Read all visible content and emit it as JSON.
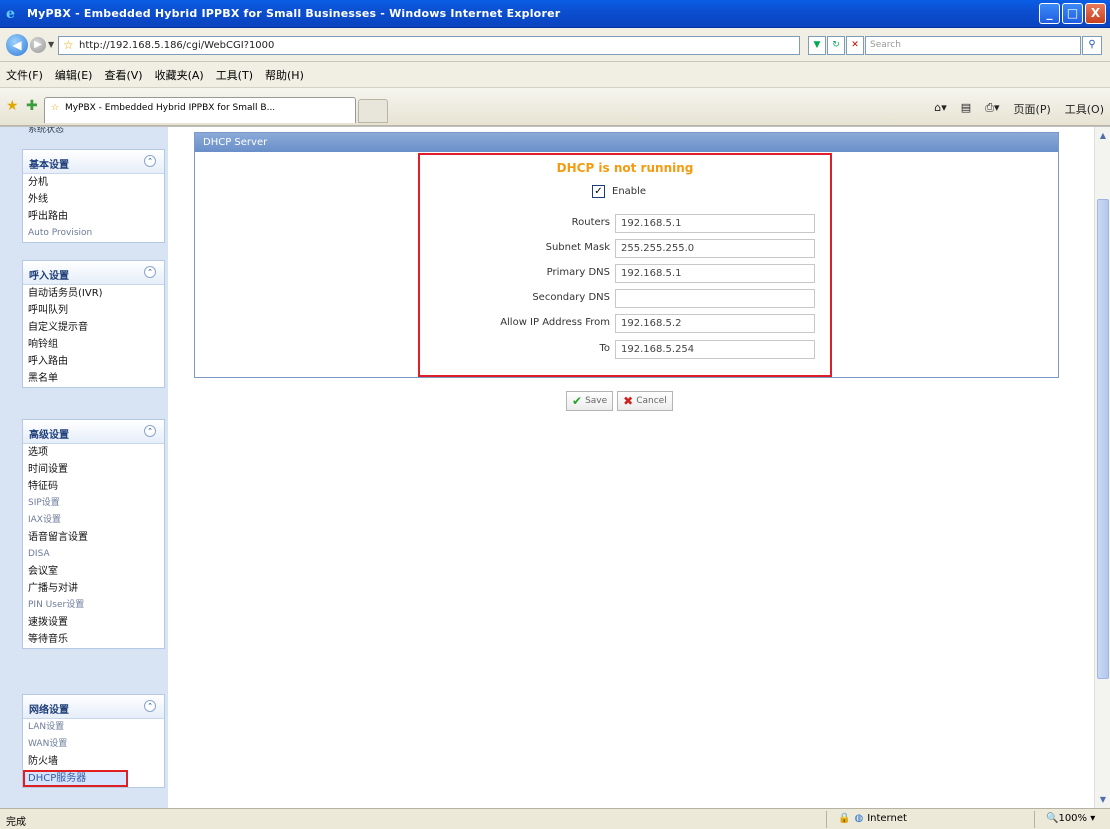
{
  "window": {
    "title": "MyPBX - Embedded Hybrid IPPBX for Small Businesses - Windows Internet Explorer",
    "buttons": [
      "_",
      "□",
      "X"
    ]
  },
  "address_bar": {
    "url": "http://192.168.5.186/cgi/WebCGI?1000",
    "search_placeholder": "Search"
  },
  "menu": [
    "文件(F)",
    "编辑(E)",
    "查看(V)",
    "收藏夹(A)",
    "工具(T)",
    "帮助(H)"
  ],
  "tab": {
    "label": "MyPBX - Embedded Hybrid IPPBX for Small B..."
  },
  "command_bar": [
    "页面(P)",
    "工具(O)"
  ],
  "sidebar": {
    "top_cut": "系统状态",
    "sections": [
      {
        "title": "基本设置",
        "items": [
          "分机",
          "外线",
          "呼出路由",
          "Auto Provision"
        ]
      },
      {
        "title": "呼入设置",
        "items": [
          "自动话务员(IVR)",
          "呼叫队列",
          "自定义提示音",
          "响铃组",
          "呼入路由",
          "黑名单"
        ]
      },
      {
        "title": "高级设置",
        "items": [
          "选项",
          "时间设置",
          "特征码",
          "SIP设置",
          "IAX设置",
          "语音留言设置",
          "DISA",
          "会议室",
          "广播与对讲",
          "PIN User设置",
          "速拨设置",
          "等待音乐"
        ]
      },
      {
        "title": "网络设置",
        "items": [
          "LAN设置",
          "WAN设置",
          "防火墙",
          "DHCP服务器"
        ]
      }
    ]
  },
  "panel": {
    "title": "DHCP Server",
    "status": "DHCP is not running",
    "enable_label": "Enable",
    "enable_checked": true,
    "fields": [
      {
        "label": "Routers",
        "value": "192.168.5.1"
      },
      {
        "label": "Subnet Mask",
        "value": "255.255.255.0"
      },
      {
        "label": "Primary DNS",
        "value": "192.168.5.1"
      },
      {
        "label": "Secondary DNS",
        "value": ""
      },
      {
        "label": "Allow IP Address From",
        "value": "192.168.5.2"
      },
      {
        "label": "To",
        "value": "192.168.5.254"
      }
    ],
    "save_label": "Save",
    "cancel_label": "Cancel"
  },
  "statusbar": {
    "left": "完成",
    "zone": "Internet",
    "zoom": "100%"
  },
  "colors": {
    "status_orange": "#f39c12",
    "highlight_red": "#e01e2a",
    "panel_header": "#6a8fc9",
    "sidebar_bg": "#d8e3f3"
  }
}
